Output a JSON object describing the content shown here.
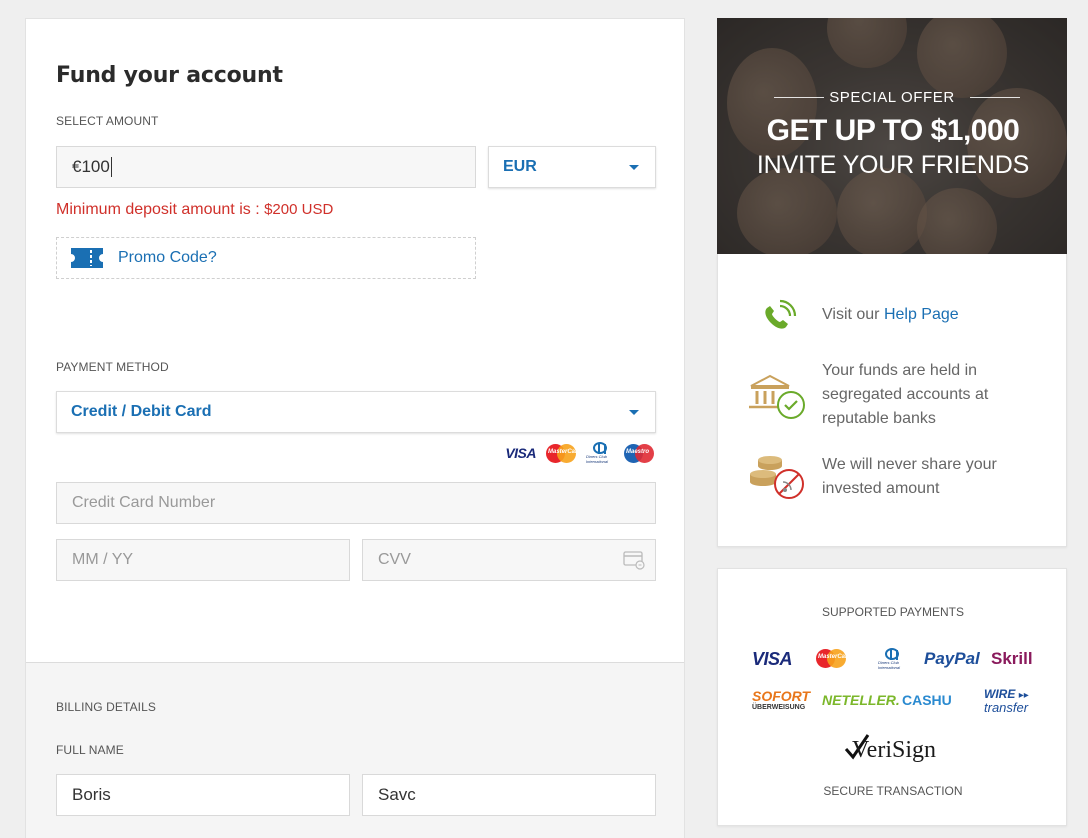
{
  "fund": {
    "title": "Fund your account",
    "select_amount_label": "SELECT AMOUNT",
    "amount_value": "€100",
    "currency": "EUR",
    "error_prefix": "Minimum deposit amount is : ",
    "error_amount": "$200 USD",
    "promo_label": "Promo Code?",
    "payment_method_label": "PAYMENT METHOD",
    "payment_method": "Credit / Debit Card",
    "card_brands": [
      "VISA",
      "MasterCard",
      "Diners Club International",
      "Maestro"
    ],
    "card_number_placeholder": "Credit Card Number",
    "expiry_placeholder": "MM / YY",
    "cvv_placeholder": "CVV"
  },
  "billing": {
    "section_label": "BILLING DETAILS",
    "full_name_label": "FULL NAME",
    "first_name": "Boris",
    "last_name": "Savc"
  },
  "banner": {
    "special_offer": "SPECIAL OFFER",
    "headline": "GET UP TO $1,000",
    "subline": "INVITE YOUR FRIENDS"
  },
  "info": {
    "help_prefix": "Visit our ",
    "help_link": "Help Page",
    "funds_line1": "Your funds are held in",
    "funds_line2": "segregated accounts at",
    "funds_line3": "reputable banks",
    "share_line1": "We will never share your",
    "share_line2": "invested amount"
  },
  "payments": {
    "title": "SUPPORTED PAYMENTS",
    "visa": "VISA",
    "mastercard": "MasterCard",
    "paypal": "PayPal",
    "skrill": "Skrill",
    "sofort": "SOFORT",
    "sofort_sub": "ÜBERWEISUNG",
    "neteller": "NETELLER.",
    "cashu": "CASHU",
    "wire1": "WIRE",
    "wire2": "transfer",
    "verisign": "VeriSign",
    "secure": "SECURE TRANSACTION"
  },
  "colors": {
    "accent": "#1a6fb3",
    "error": "#d0302a",
    "green": "#6aaa2a"
  }
}
